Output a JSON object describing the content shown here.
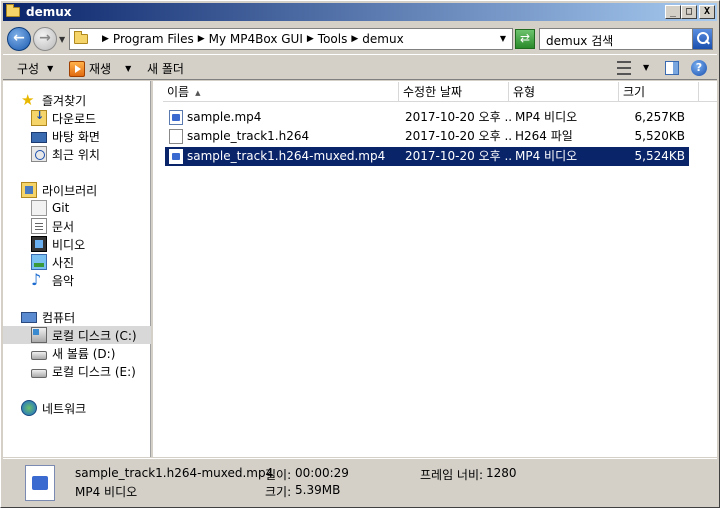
{
  "window": {
    "title": "demux",
    "buttons": {
      "minimize": "_",
      "maximize": "□",
      "close": "X"
    }
  },
  "address": {
    "crumbs": [
      "Program Files",
      "My MP4Box GUI",
      "Tools",
      "demux"
    ],
    "search_placeholder": "demux 검색"
  },
  "toolbar": {
    "organize_label": "구성",
    "play_label": "재생",
    "new_folder_label": "새 폴더"
  },
  "nav": {
    "favorites": {
      "label": "즐겨찾기",
      "items": [
        "다운로드",
        "바탕 화면",
        "최근 위치"
      ]
    },
    "libraries": {
      "label": "라이브러리",
      "items": [
        "Git",
        "문서",
        "비디오",
        "사진",
        "음악"
      ]
    },
    "computer": {
      "label": "컴퓨터",
      "items": [
        "로컬 디스크 (C:)",
        "새 볼륨 (D:)",
        "로컬 디스크 (E:)"
      ],
      "selected_index": 0
    },
    "network": {
      "label": "네트워크"
    }
  },
  "columns": [
    "이름",
    "수정한 날짜",
    "유형",
    "크기"
  ],
  "files": [
    {
      "name": "sample.mp4",
      "date": "2017-10-20 오후 ...",
      "type": "MP4 비디오",
      "size": "6,257KB",
      "icon": "mp4-icon"
    },
    {
      "name": "sample_track1.h264",
      "date": "2017-10-20 오후 ...",
      "type": "H264 파일",
      "size": "5,520KB",
      "icon": "file-icon"
    },
    {
      "name": "sample_track1.h264-muxed.mp4",
      "date": "2017-10-20 오후 ...",
      "type": "MP4 비디오",
      "size": "5,524KB",
      "icon": "mp4-icon",
      "selected": true
    }
  ],
  "details": {
    "filename": "sample_track1.h264-muxed.mp4",
    "filetype": "MP4 비디오",
    "length_label": "길이:",
    "length_value": "00:00:29",
    "size_label": "크기:",
    "size_value": "5.39MB",
    "frame_width_label": "프레임 너비:",
    "frame_width_value": "1280"
  }
}
